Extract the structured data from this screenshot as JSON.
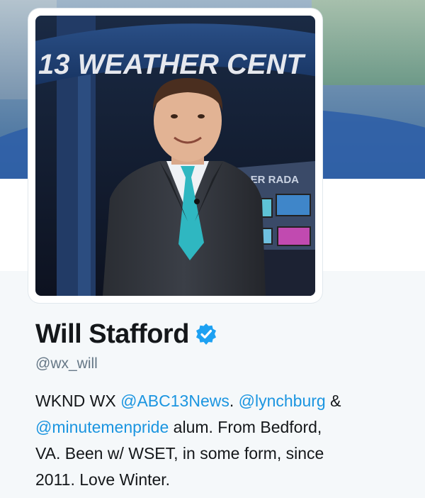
{
  "profile": {
    "name": "Will Stafford",
    "handle": "@wx_will",
    "verified": true,
    "avatar_sign_text": "13 WEATHER CENT",
    "avatar_sub_sign": "DOPPLER RADA",
    "bio": {
      "line1_a": "WKND WX ",
      "mention1": "@ABC13News",
      "line1_b": ". ",
      "mention2": "@lynchburg",
      "line1_c": " &",
      "mention3": "@minutemenpride",
      "line2_b": " alum. From Bedford,",
      "line3": "VA. Been w/ WSET, in some form, since",
      "line4": "2011. Love Winter."
    }
  },
  "colors": {
    "link": "#1b95e0",
    "name": "#14171a",
    "handle": "#657786",
    "verified": "#1da1f2"
  }
}
